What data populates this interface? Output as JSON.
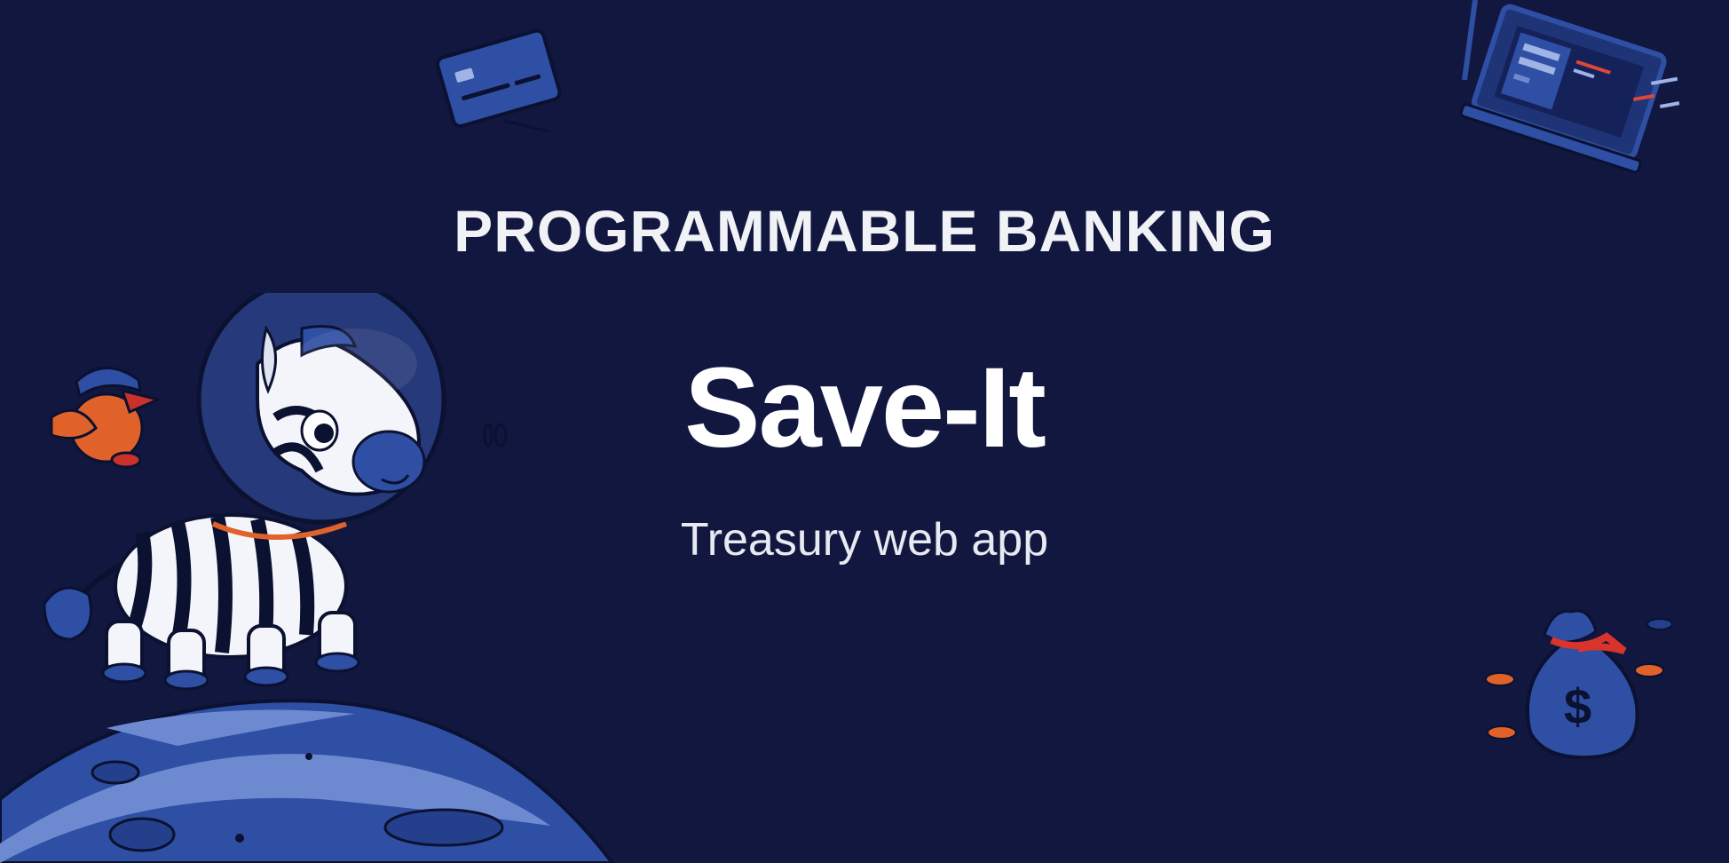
{
  "hero": {
    "eyebrow": "PROGRAMMABLE BANKING",
    "title": "Save-It",
    "subtitle": "Treasury web app"
  },
  "colors": {
    "background": "#11173f",
    "text": "#f1f2f6",
    "accent_blue": "#2e4fa3",
    "light_blue": "#6d8ad1",
    "orange": "#e0622a"
  },
  "illustrations": [
    "credit-card-icon",
    "laptop-icon",
    "astronaut-zebra",
    "bird-mascot",
    "planet",
    "money-bag-icon",
    "coins"
  ]
}
